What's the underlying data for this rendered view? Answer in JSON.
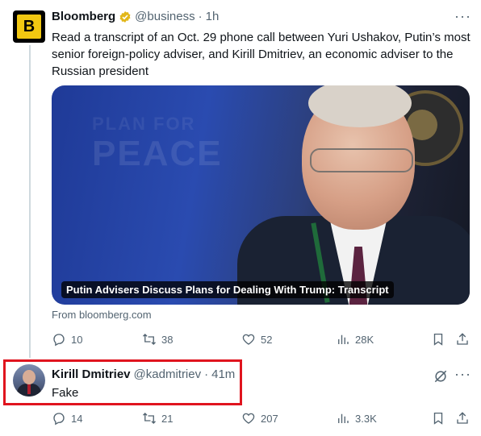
{
  "tweet": {
    "author_name": "Bloomberg",
    "handle": "@business",
    "separator": "·",
    "time": "1h",
    "avatar_letter": "B",
    "more_label": "···",
    "text": "Read a transcript of an Oct. 29 phone call between Yuri Ushakov, Putin’s most senior foreign-policy adviser, and Kirill Dmitriev, an economic adviser to the Russian president",
    "card_caption": "Putin Advisers Discuss Plans for Dealing With Trump: Transcript",
    "card_background_text": "PEACE",
    "card_background_text_small": "PLAN FOR",
    "from_line": "From bloomberg.com",
    "stats": {
      "replies": "10",
      "reposts": "38",
      "likes": "52",
      "views": "28K"
    }
  },
  "reply": {
    "author_name": "Kirill Dmitriev",
    "handle": "@kadmitriev",
    "separator": "·",
    "time": "41m",
    "more_label": "···",
    "text": "Fake",
    "stats": {
      "replies": "14",
      "reposts": "21",
      "likes": "207",
      "views": "3.3K"
    }
  },
  "colors": {
    "verified_gold": "#e2b719",
    "highlight_red": "#e0141e",
    "muted": "#536471"
  },
  "icons": [
    "verified-badge-icon",
    "reply-icon",
    "repost-icon",
    "like-icon",
    "views-icon",
    "bookmark-icon",
    "share-icon",
    "grok-icon",
    "more-icon"
  ]
}
